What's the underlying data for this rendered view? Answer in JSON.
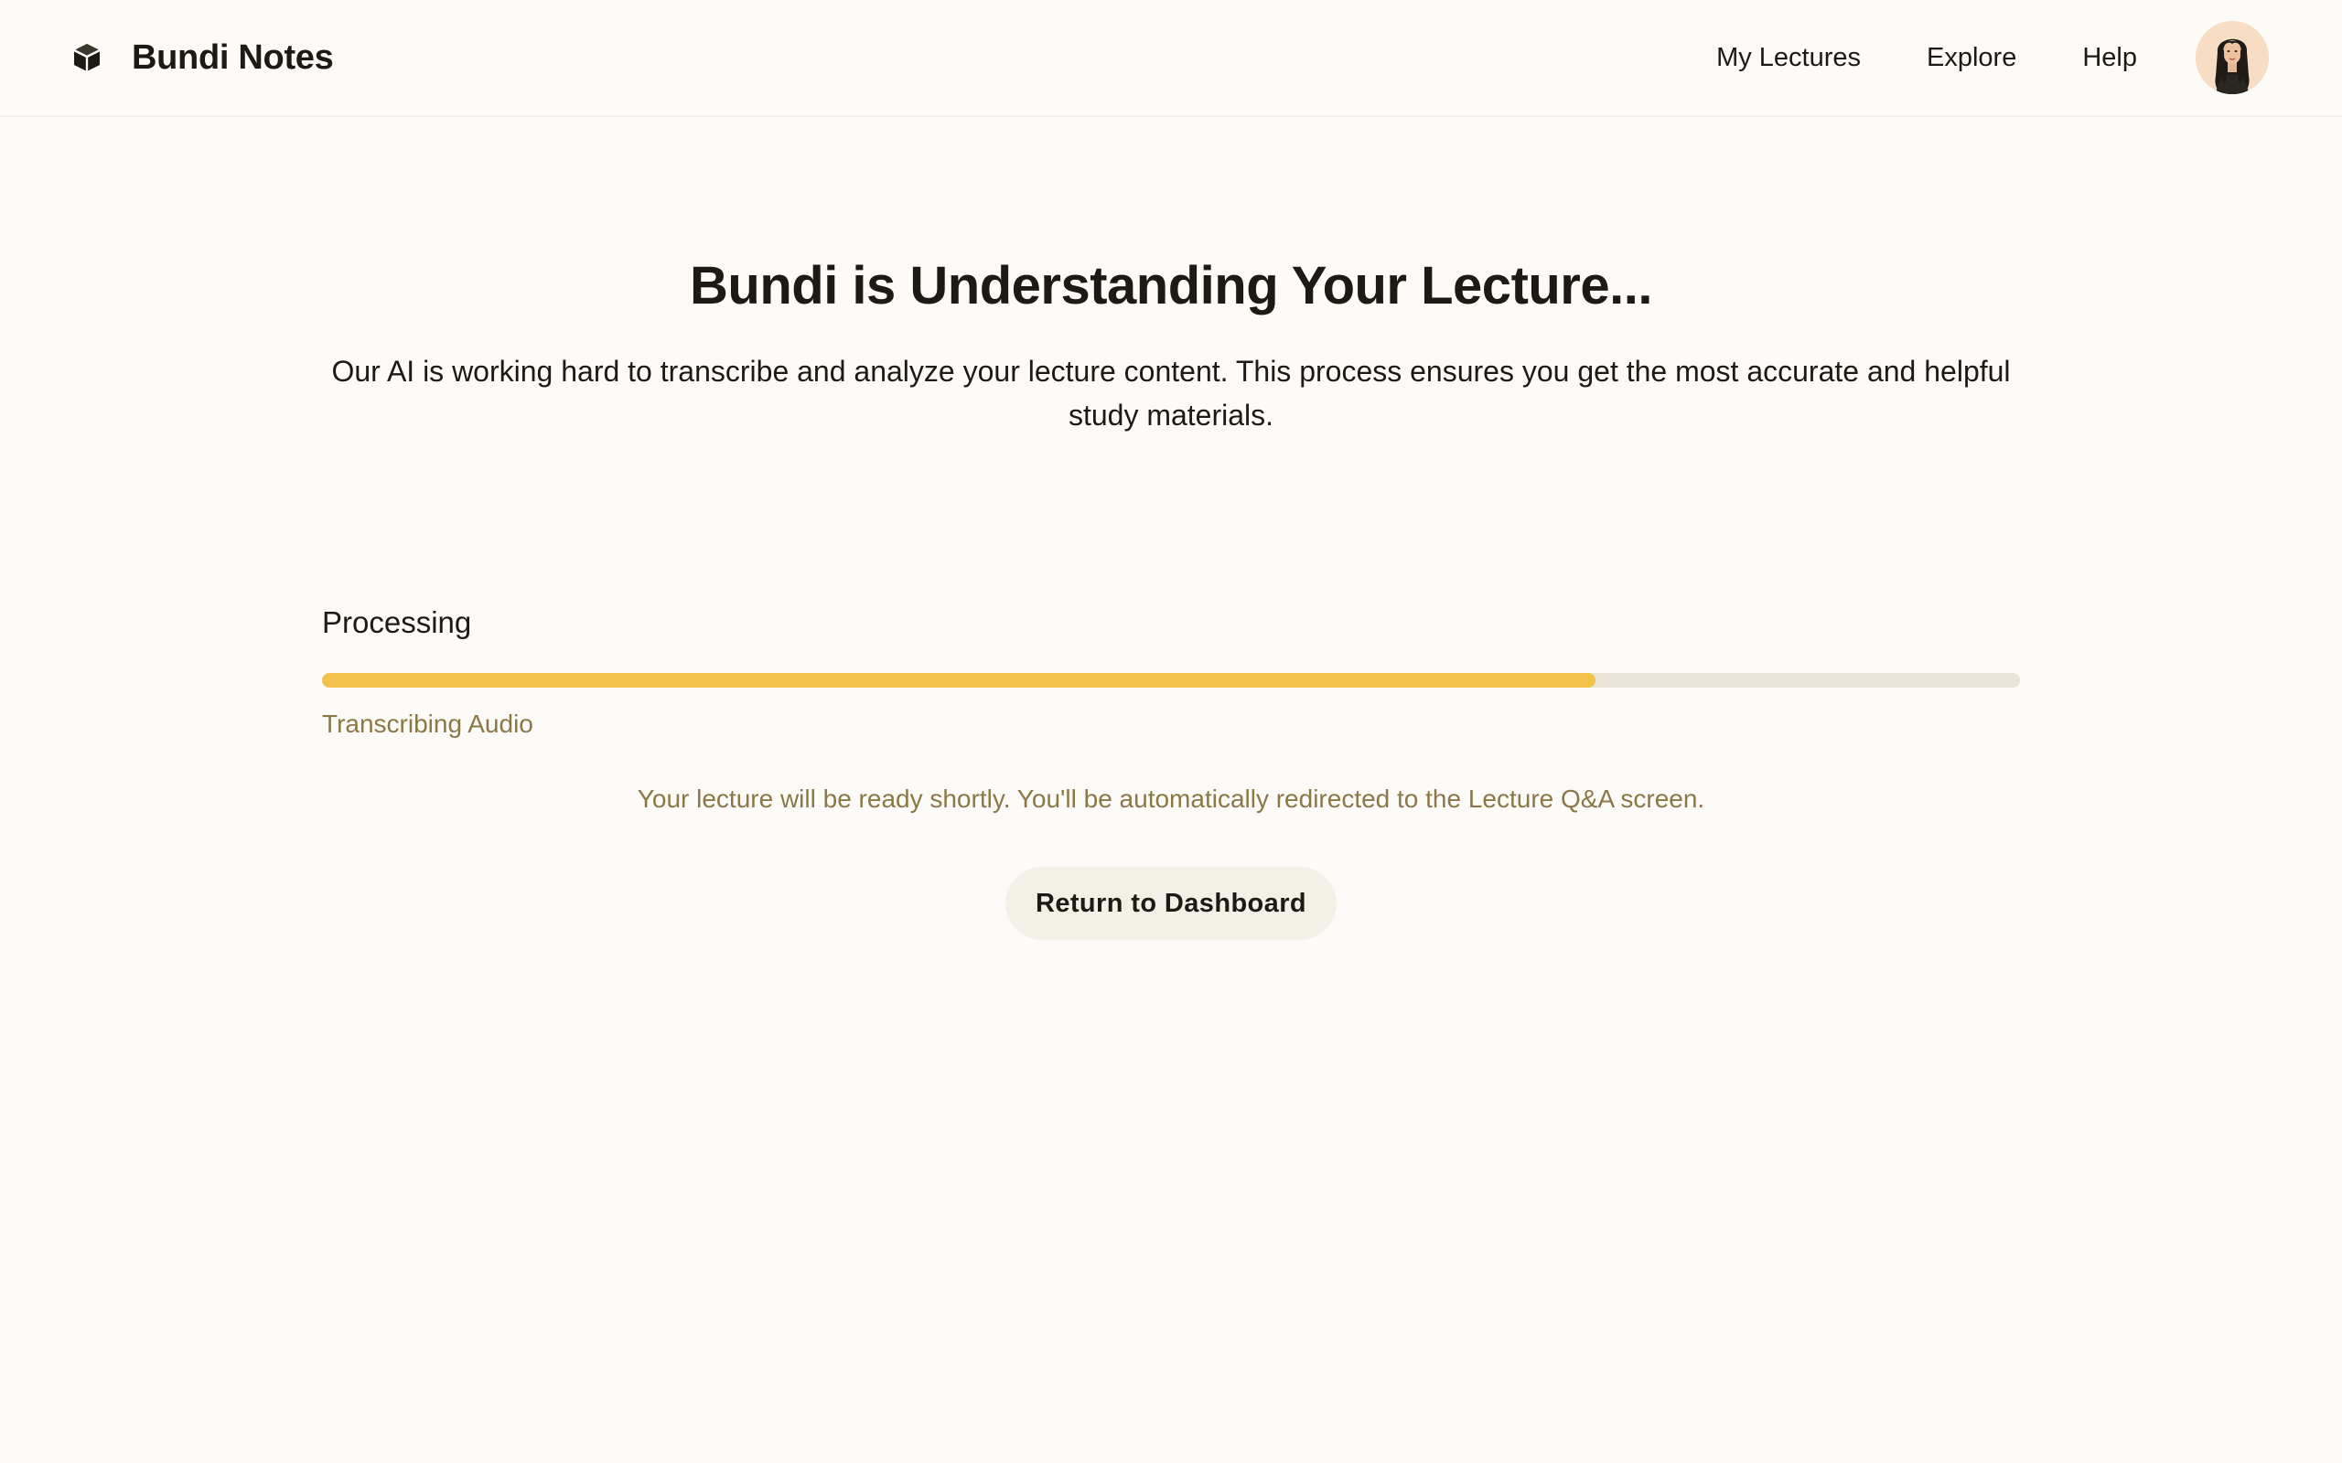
{
  "header": {
    "brand_name": "Bundi Notes",
    "brand_icon": "cube-icon",
    "nav": [
      {
        "label": "My Lectures"
      },
      {
        "label": "Explore"
      },
      {
        "label": "Help"
      }
    ],
    "avatar_icon": "user-avatar"
  },
  "main": {
    "title": "Bundi is Understanding Your Lecture...",
    "subtitle": "Our AI is working hard to transcribe and analyze your lecture content. This process ensures you get the most accurate and helpful study materials.",
    "progress": {
      "label": "Processing",
      "percent": 75,
      "status": "Transcribing Audio"
    },
    "notice": "Your lecture will be ready shortly. You'll be automatically redirected to the Lecture Q&A screen.",
    "return_button_label": "Return to Dashboard"
  },
  "colors": {
    "background": "#fcfbf8",
    "text": "#1c1a12",
    "muted": "#8c7846",
    "progress_fill": "#f2c24b",
    "progress_track": "#e9e4d8",
    "button_bg": "#f3f0e8",
    "avatar_bg": "#f6ddc4"
  }
}
